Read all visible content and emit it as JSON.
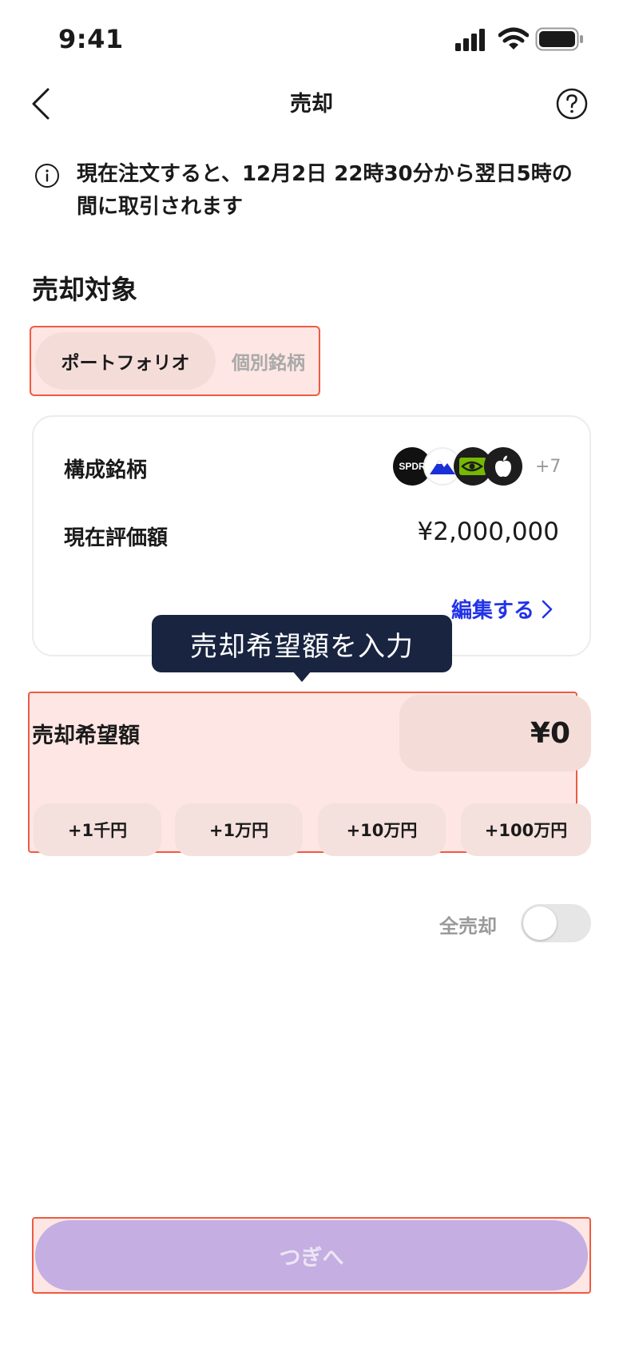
{
  "status_bar": {
    "time": "9:41"
  },
  "header": {
    "title": "売却"
  },
  "notice": {
    "text": "現在注文すると、12月2日 22時30分から翌日5時の間に取引されます"
  },
  "section": {
    "title": "売却対象"
  },
  "segment": {
    "active_label": "ポートフォリオ",
    "inactive_label": "個別銘柄"
  },
  "card": {
    "constituents_label": "構成銘柄",
    "logos": {
      "spdr": "SPDR"
    },
    "more_count": "+7",
    "valuation_label": "現在評価額",
    "valuation_value": "¥2,000,000",
    "edit_label": "編集する"
  },
  "tooltip": {
    "text": "売却希望額を入力"
  },
  "amount": {
    "label": "売却希望額",
    "value": "¥0",
    "chips": [
      "+1千円",
      "+1万円",
      "+10万円",
      "+100万円"
    ]
  },
  "sell_all": {
    "label": "全売却",
    "enabled": false
  },
  "footer": {
    "next_label": "つぎへ"
  },
  "colors": {
    "accent_blue": "#2233e8",
    "next_button": "#c5aee1",
    "tooltip_bg": "#182440",
    "highlight_border": "#ef5a42"
  }
}
